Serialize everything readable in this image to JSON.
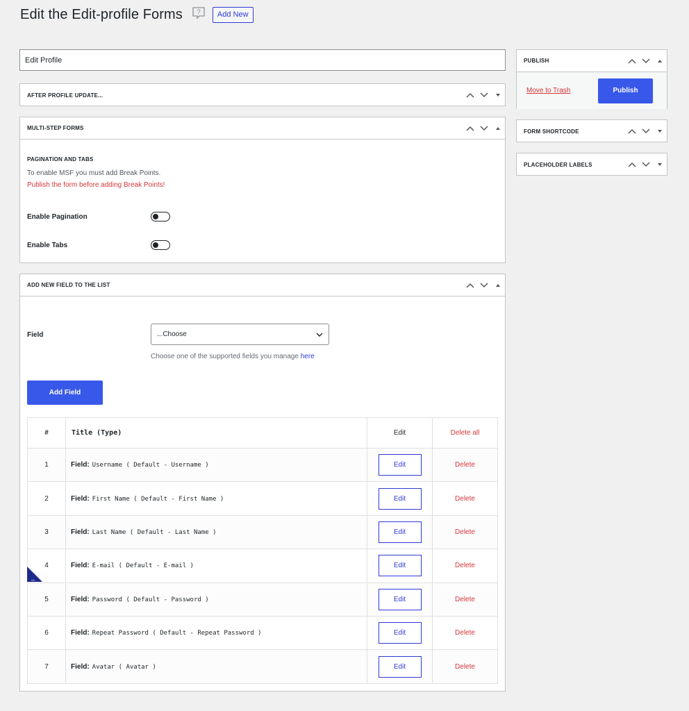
{
  "header": {
    "title": "Edit the Edit-profile Forms",
    "add_new_label": "Add New"
  },
  "form_title": {
    "value": "Edit Profile"
  },
  "boxes": {
    "after_update": {
      "title": "AFTER PROFILE UPDATE..."
    },
    "msf": {
      "title": "MULTI-STEP FORMS",
      "subtitle": "PAGINATION AND TABS",
      "note": "To enable MSF you must add Break Points.",
      "warning": "Publish the form before adding Break Points!",
      "pagination_label": "Enable Pagination",
      "tabs_label": "Enable Tabs"
    },
    "add_field": {
      "title": "ADD NEW FIELD TO THE LIST",
      "field_label": "Field",
      "select_value": "...Choose",
      "desc": "Choose one of the supported fields you manage",
      "desc_link": "here",
      "button_label": "Add Field"
    }
  },
  "table": {
    "headers": {
      "num": "#",
      "title": "Title (Type)",
      "edit": "Edit",
      "delete_all": "Delete all"
    },
    "field_prefix": "Field:",
    "edit_label": "Edit",
    "delete_label": "Delete",
    "rows": [
      {
        "num": "1",
        "value": "Username ( Default - Username )"
      },
      {
        "num": "2",
        "value": "First Name ( Default - First Name )"
      },
      {
        "num": "3",
        "value": "Last Name ( Default - Last Name )"
      },
      {
        "num": "4",
        "value": "E-mail ( Default - E-mail )"
      },
      {
        "num": "5",
        "value": "Password ( Default - Password )"
      },
      {
        "num": "6",
        "value": "Repeat Password ( Default - Repeat Password )"
      },
      {
        "num": "7",
        "value": "Avatar ( Avatar )"
      }
    ],
    "breakpoint_marker": "–"
  },
  "sidebar": {
    "publish": {
      "title": "PUBLISH",
      "trash_label": "Move to Trash",
      "publish_label": "Publish"
    },
    "shortcode": {
      "title": "FORM SHORTCODE"
    },
    "placeholders": {
      "title": "PLACEHOLDER LABELS"
    }
  },
  "colors": {
    "accent": "#3858e9",
    "danger": "#d63638",
    "link": "#2c3ad6"
  }
}
